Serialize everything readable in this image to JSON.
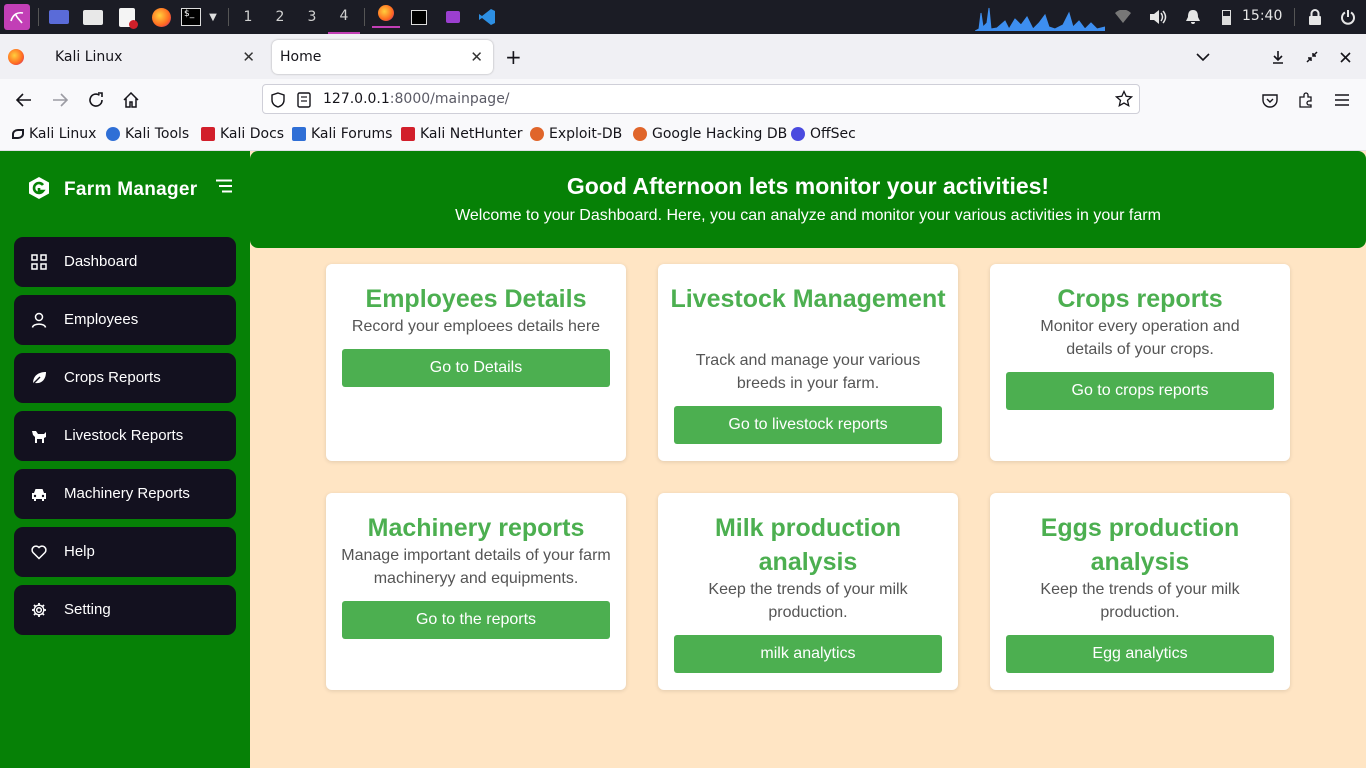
{
  "os": {
    "workspaces": [
      "1",
      "2",
      "3",
      "4"
    ],
    "clock": "15:40"
  },
  "browser": {
    "tabs": [
      {
        "label": "Kali Linux"
      },
      {
        "label": "Home"
      }
    ],
    "new_tab": "+",
    "url": {
      "host": "127.0.0.1",
      "rest": ":8000/mainpage/"
    },
    "bookmarks": [
      {
        "label": "Kali Linux",
        "color": "#1b1c25"
      },
      {
        "label": "Kali Tools",
        "color": "#2f6fd6"
      },
      {
        "label": "Kali Docs",
        "color": "#d21f2b"
      },
      {
        "label": "Kali Forums",
        "color": "#2f6fd6"
      },
      {
        "label": "Kali NetHunter",
        "color": "#d21f2b"
      },
      {
        "label": "Exploit-DB",
        "color": "#e0652a"
      },
      {
        "label": "Google Hacking DB",
        "color": "#e0652a"
      },
      {
        "label": "OffSec",
        "color": "#4a4adf"
      }
    ]
  },
  "app": {
    "brand": "Farm Manager",
    "nav": [
      {
        "label": "Dashboard",
        "icon": "grid-icon"
      },
      {
        "label": "Employees",
        "icon": "user-icon"
      },
      {
        "label": "Crops Reports",
        "icon": "leaf-icon"
      },
      {
        "label": "Livestock Reports",
        "icon": "animal-icon"
      },
      {
        "label": "Machinery Reports",
        "icon": "car-icon"
      },
      {
        "label": "Help",
        "icon": "heart-icon"
      },
      {
        "label": "Setting",
        "icon": "gear-icon"
      }
    ],
    "banner": {
      "title": "Good Afternoon lets monitor your activities!",
      "subtitle": "Welcome to your Dashboard. Here, you can analyze and monitor your various activities in your farm"
    },
    "cards": [
      {
        "title": "Employees Details",
        "desc": "Record your emploees details here",
        "button": "Go to Details"
      },
      {
        "title": "Livestock Management",
        "desc": "Track and manage your various breeds in your farm.",
        "button": "Go to livestock reports"
      },
      {
        "title": "Crops reports",
        "desc": "Monitor every operation and details of your crops.",
        "button": "Go to crops reports"
      },
      {
        "title": "Machinery reports",
        "desc": "Manage important details of your farm machineryy and equipments.",
        "button": "Go to the reports"
      },
      {
        "title": "Milk production analysis",
        "desc": "Keep the trends of your milk production.",
        "button": "milk analytics"
      },
      {
        "title": "Eggs production analysis",
        "desc": "Keep the trends of your milk production.",
        "button": "Egg analytics"
      }
    ],
    "colors": {
      "sidebar": "#068106",
      "accent": "#4caf50",
      "nav_bg": "#13111f",
      "page_bg": "#ffe5c4"
    }
  }
}
